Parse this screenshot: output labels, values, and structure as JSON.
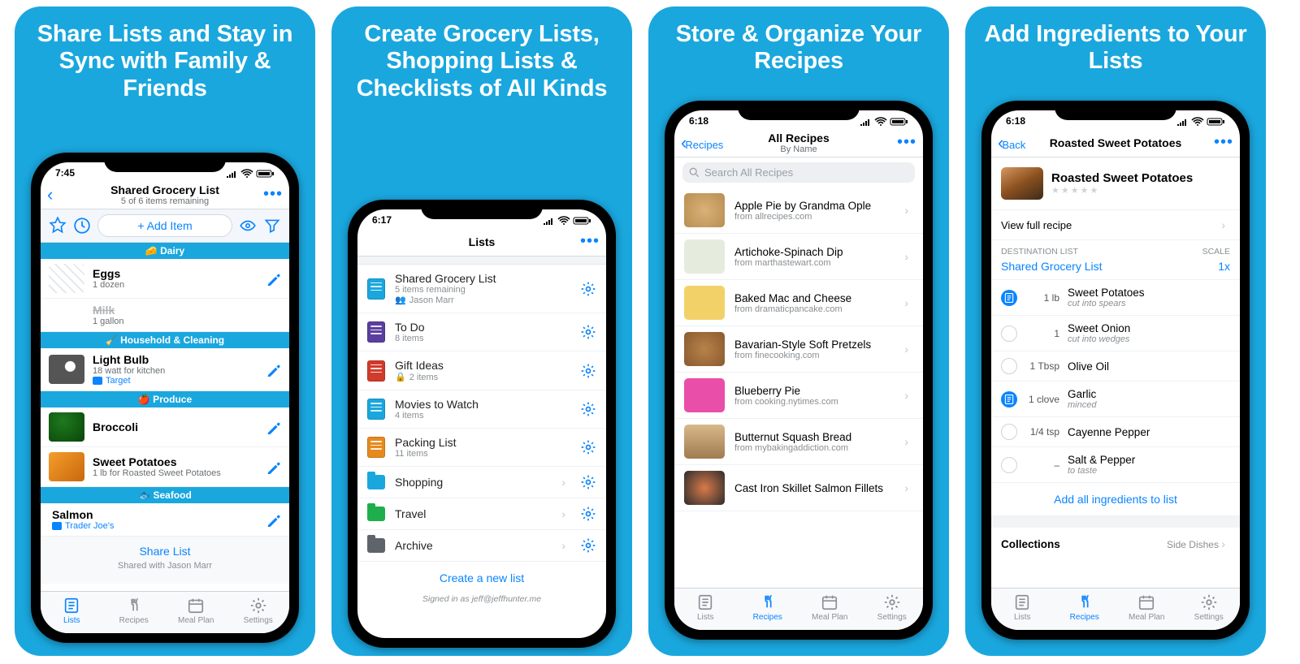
{
  "panel1": {
    "headline": "Share Lists and Stay in Sync with Family & Friends",
    "time": "7:45",
    "title": "Shared Grocery List",
    "subtitle": "5 of 6 items remaining",
    "add_btn": "+ Add Item",
    "cats": {
      "dairy": "🧀  Dairy",
      "house": "🧹  Household & Cleaning",
      "produce": "🍎  Produce",
      "seafood": "🐟  Seafood"
    },
    "items": {
      "eggs": {
        "name": "Eggs",
        "meta": "1 dozen"
      },
      "milk": {
        "name": "Milk",
        "meta": "1 gallon"
      },
      "bulb": {
        "name": "Light Bulb",
        "meta": "18 watt for kitchen",
        "store": "Target"
      },
      "broccoli": {
        "name": "Broccoli"
      },
      "sweet": {
        "name": "Sweet Potatoes",
        "meta": "1 lb for Roasted Sweet Potatoes"
      },
      "salmon": {
        "name": "Salmon",
        "store": "Trader Joe's"
      }
    },
    "share": "Share List",
    "shared_with": "Shared with Jason Marr",
    "tabs": [
      "Lists",
      "Recipes",
      "Meal Plan",
      "Settings"
    ]
  },
  "panel2": {
    "headline": "Create Grocery Lists, Shopping Lists & Checklists of All Kinds",
    "time": "6:17",
    "title": "Lists",
    "rows": [
      {
        "name": "Shared Grocery List",
        "sub": "5 items remaining",
        "extra": "Jason Marr",
        "c": "#1aa7de",
        "type": "note"
      },
      {
        "name": "To Do",
        "sub": "8 items",
        "c": "#5a3fa0",
        "type": "note"
      },
      {
        "name": "Gift Ideas",
        "sub": "2 items",
        "lock": true,
        "c": "#d13b2a",
        "type": "note"
      },
      {
        "name": "Movies to Watch",
        "sub": "4 items",
        "c": "#1aa7de",
        "type": "note"
      },
      {
        "name": "Packing List",
        "sub": "11 items",
        "c": "#e68a1d",
        "type": "note"
      },
      {
        "name": "Shopping",
        "chev": true,
        "c": "#1aa7de",
        "type": "folder"
      },
      {
        "name": "Travel",
        "chev": true,
        "c": "#1fae4c",
        "type": "folder"
      },
      {
        "name": "Archive",
        "chev": true,
        "c": "#5e6469",
        "type": "folder"
      }
    ],
    "newlist": "Create a new list",
    "signed": "Signed in as jeff@jeffhunter.me"
  },
  "panel3": {
    "headline": "Store & Organize Your Recipes",
    "time": "6:18",
    "back": "Recipes",
    "title": "All Recipes",
    "subtitle": "By Name",
    "search": "Search All Recipes",
    "recipes": [
      {
        "name": "Apple Pie by Grandma Ople",
        "src": "from allrecipes.com",
        "img": "img-applepie"
      },
      {
        "name": "Artichoke-Spinach Dip",
        "src": "from marthastewart.com",
        "img": "img-artichoke"
      },
      {
        "name": "Baked Mac and Cheese",
        "src": "from dramaticpancake.com",
        "img": "img-mac"
      },
      {
        "name": "Bavarian-Style Soft Pretzels",
        "src": "from finecooking.com",
        "img": "img-pretzel"
      },
      {
        "name": "Blueberry Pie",
        "src": "from cooking.nytimes.com",
        "img": "img-bluepie"
      },
      {
        "name": "Butternut Squash Bread",
        "src": "from mybakingaddiction.com",
        "img": "img-squash"
      },
      {
        "name": "Cast Iron Skillet Salmon Fillets",
        "src": "",
        "img": "img-salmon"
      }
    ],
    "tabs": [
      "Lists",
      "Recipes",
      "Meal Plan",
      "Settings"
    ]
  },
  "panel4": {
    "headline": "Add Ingredients to Your Lists",
    "time": "6:18",
    "back": "Back",
    "title": "Roasted Sweet Potatoes",
    "hero_name": "Roasted Sweet Potatoes",
    "viewfull": "View full recipe",
    "dest_label": "DESTINATION LIST",
    "scale_label": "SCALE",
    "dest_value": "Shared Grocery List",
    "scale_value": "1x",
    "ings": [
      {
        "on": true,
        "qty": "1 lb",
        "name": "Sweet Potatoes",
        "prep": "cut into spears"
      },
      {
        "on": false,
        "qty": "1",
        "name": "Sweet Onion",
        "prep": "cut into wedges"
      },
      {
        "on": false,
        "qty": "1 Tbsp",
        "name": "Olive Oil"
      },
      {
        "on": true,
        "qty": "1 clove",
        "name": "Garlic",
        "prep": "minced"
      },
      {
        "on": false,
        "qty": "1/4 tsp",
        "name": "Cayenne Pepper"
      },
      {
        "on": false,
        "qty": "–",
        "name": "Salt & Pepper",
        "prep": "to taste"
      }
    ],
    "addall": "Add all ingredients to list",
    "collections": "Collections",
    "collection_val": "Side Dishes",
    "tabs": [
      "Lists",
      "Recipes",
      "Meal Plan",
      "Settings"
    ]
  }
}
